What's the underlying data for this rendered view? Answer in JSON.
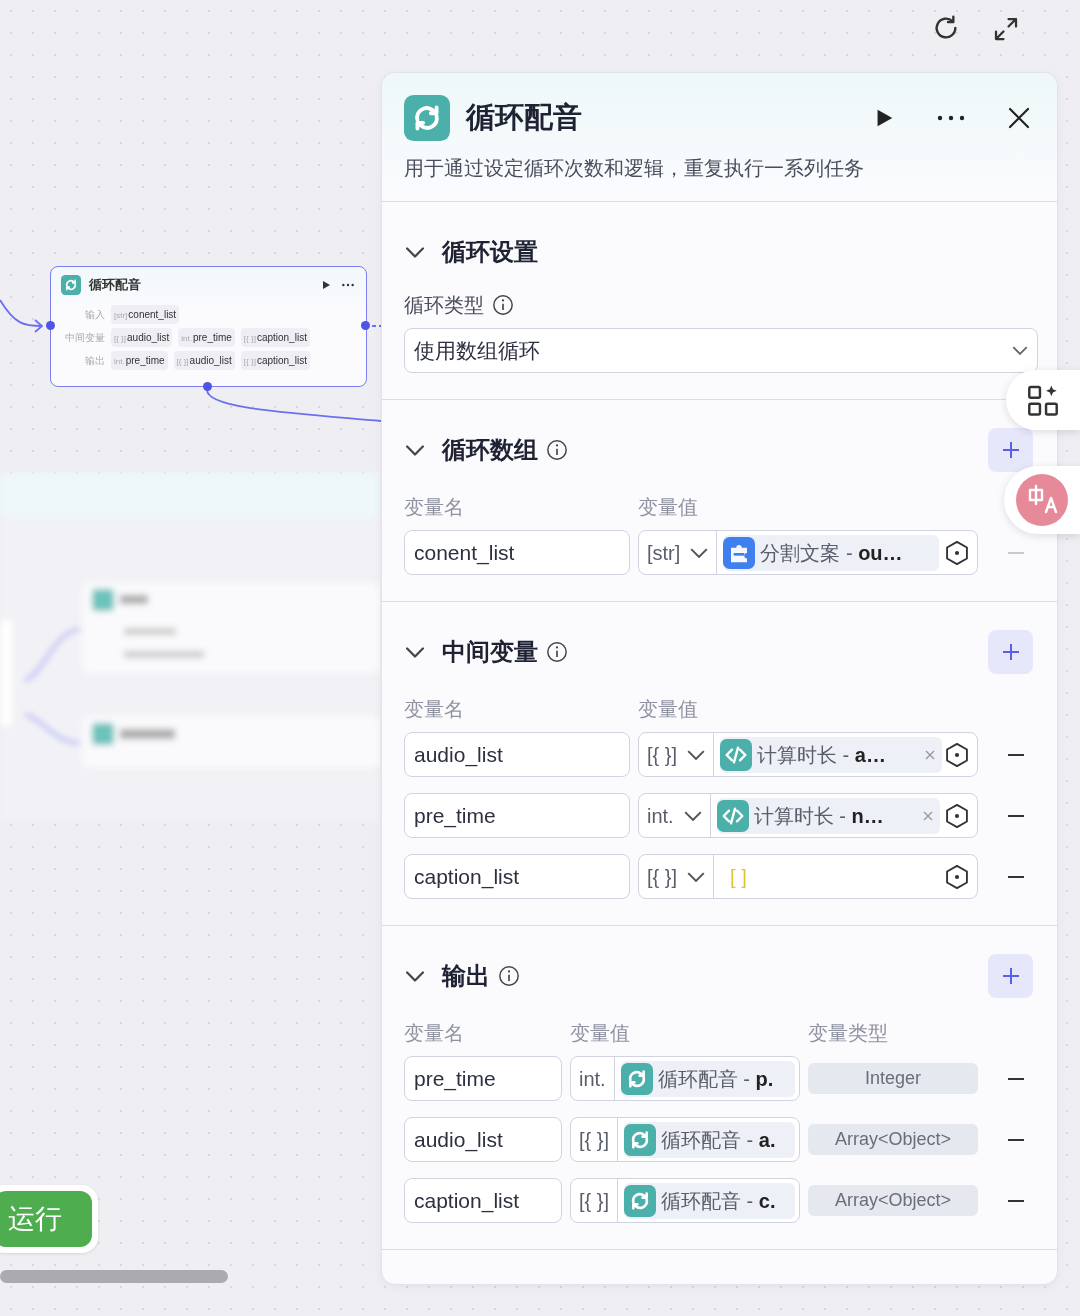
{
  "canvas": {
    "node": {
      "title": "循环配音",
      "rows": [
        {
          "label": "输入",
          "tags": [
            {
              "type": "[str]",
              "name": "conent_list"
            }
          ]
        },
        {
          "label": "中间变量",
          "tags": [
            {
              "type": "[{ }]",
              "name": "audio_list"
            },
            {
              "type": "int.",
              "name": "pre_time"
            },
            {
              "type": "[{ }]",
              "name": "caption_list"
            }
          ]
        },
        {
          "label": "输出",
          "tags": [
            {
              "type": "int.",
              "name": "pre_time"
            },
            {
              "type": "[{ }]",
              "name": "audio_list"
            },
            {
              "type": "[{ }]",
              "name": "caption_list"
            }
          ]
        }
      ]
    },
    "run_button": "运行"
  },
  "panel": {
    "title": "循环配音",
    "description": "用于通过设定循环次数和逻辑，重复执行一系列任务",
    "sections": [
      {
        "kind": "settings",
        "title": "循环设置",
        "expanded": true,
        "field_label": "循环类型",
        "select_value": "使用数组循环"
      },
      {
        "kind": "variables",
        "title": "循环数组",
        "expanded": true,
        "columns": [
          "变量名",
          "变量值"
        ],
        "rows": [
          {
            "name": "conent_list",
            "type": "[str]",
            "value": {
              "kind": "plugin",
              "text": "分割文案 - **ou…**"
            },
            "removable": false
          }
        ]
      },
      {
        "kind": "variables",
        "title": "中间变量",
        "expanded": true,
        "columns": [
          "变量名",
          "变量值"
        ],
        "rows": [
          {
            "name": "audio_list",
            "type": "[{ }]",
            "value": {
              "kind": "code",
              "text": "计算时长 - **a…**",
              "clearable": true
            },
            "removable": true
          },
          {
            "name": "pre_time",
            "type": "int.",
            "value": {
              "kind": "code",
              "text": "计算时长 - **n…**",
              "clearable": true
            },
            "removable": true
          },
          {
            "name": "caption_list",
            "type": "[{ }]",
            "value": {
              "kind": "literal",
              "text": "[ ]"
            },
            "removable": true
          }
        ]
      },
      {
        "kind": "outputs",
        "title": "输出",
        "expanded": true,
        "columns": [
          "变量名",
          "变量值",
          "变量类型"
        ],
        "rows": [
          {
            "name": "pre_time",
            "type": "int.",
            "value": {
              "kind": "loop",
              "text": "循环配音 - **p.**"
            },
            "value_type": "Integer",
            "removable": true
          },
          {
            "name": "audio_list",
            "type": "[{ }]",
            "value": {
              "kind": "loop",
              "text": "循环配音 - **a.**"
            },
            "value_type": "Array<Object>",
            "removable": true
          },
          {
            "name": "caption_list",
            "type": "[{ }]",
            "value": {
              "kind": "loop",
              "text": "循环配音 - **c.**"
            },
            "value_type": "Array<Object>",
            "removable": true
          }
        ]
      }
    ]
  }
}
